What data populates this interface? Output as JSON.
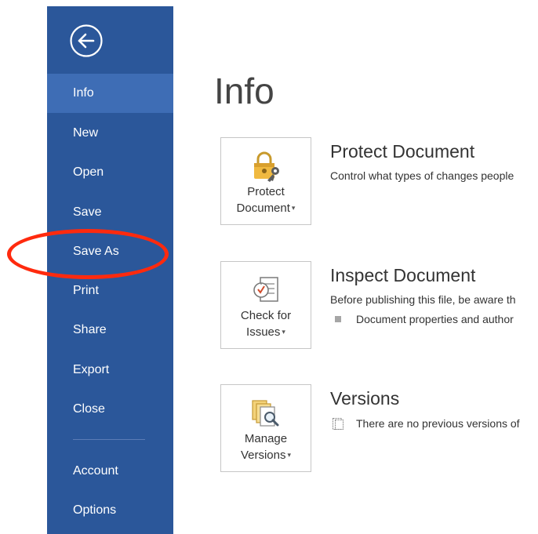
{
  "sidebar": {
    "items": [
      {
        "label": "Info",
        "selected": true
      },
      {
        "label": "New"
      },
      {
        "label": "Open"
      },
      {
        "label": "Save"
      },
      {
        "label": "Save As"
      },
      {
        "label": "Print"
      },
      {
        "label": "Share"
      },
      {
        "label": "Export"
      },
      {
        "label": "Close"
      },
      {
        "label": "Account"
      },
      {
        "label": "Options"
      }
    ]
  },
  "main": {
    "title": "Info",
    "sections": [
      {
        "button_line1": "Protect",
        "button_line2": "Document",
        "title": "Protect Document",
        "description": "Control what types of changes people"
      },
      {
        "button_line1": "Check for",
        "button_line2": "Issues",
        "title": "Inspect Document",
        "description": "Before publishing this file, be aware th",
        "items": [
          "Document properties and author"
        ]
      },
      {
        "button_line1": "Manage",
        "button_line2": "Versions",
        "title": "Versions",
        "items": [
          "There are no previous versions of"
        ]
      }
    ]
  },
  "colors": {
    "sidebar_bg": "#2b579a",
    "selected_item_bg": "#3e6db5",
    "highlight": "#ff2a0e"
  },
  "icons": {
    "back": "arrow-left-circle-icon",
    "protect": "lock-key-icon",
    "inspect": "checklist-clock-icon",
    "versions": "document-stack-magnifier-icon"
  }
}
